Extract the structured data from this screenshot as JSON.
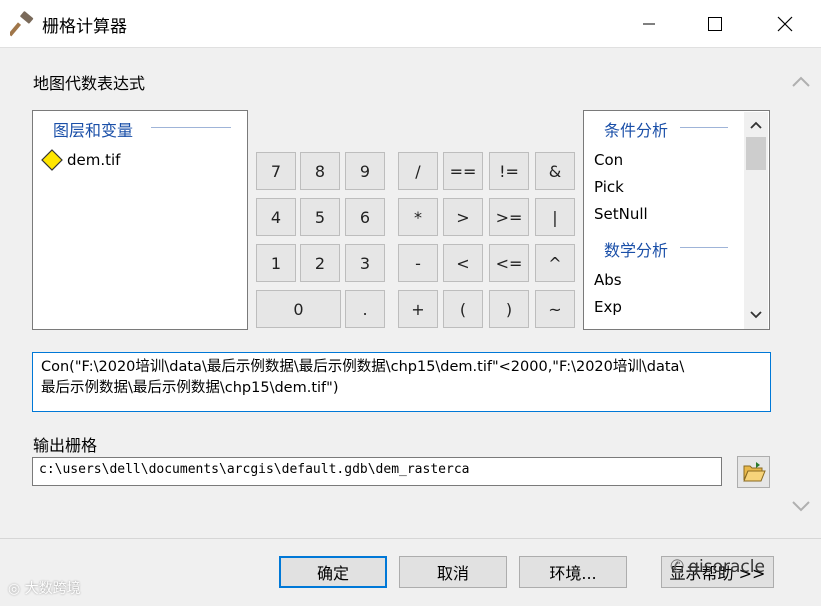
{
  "window": {
    "title": "栅格计算器"
  },
  "sections": {
    "expression_label": "地图代数表达式",
    "output_label": "输出栅格"
  },
  "layers": {
    "header": "图层和变量",
    "items": [
      "dem.tif"
    ]
  },
  "functions": {
    "group1": "条件分析",
    "group1_items": [
      "Con",
      "Pick",
      "SetNull"
    ],
    "group2": "数学分析",
    "group2_items": [
      "Abs",
      "Exp"
    ]
  },
  "keypad": {
    "row1": [
      "7",
      "8",
      "9",
      "/",
      "==",
      "!=",
      "&"
    ],
    "row2": [
      "4",
      "5",
      "6",
      "*",
      ">",
      ">=",
      "|"
    ],
    "row3": [
      "1",
      "2",
      "3",
      "-",
      "<",
      "<=",
      "^"
    ],
    "row4": [
      "0",
      ".",
      "+",
      "(",
      ")",
      "~"
    ]
  },
  "expression": {
    "line1": "Con(\"F:\\2020培训\\data\\最后示例数据\\最后示例数据\\chp15\\dem.tif\"<2000,\"F:\\2020培训\\data\\",
    "line2": "最后示例数据\\最后示例数据\\chp15\\dem.tif\")"
  },
  "output": {
    "value": "c:\\users\\dell\\documents\\arcgis\\default.gdb\\dem_rasterca"
  },
  "buttons": {
    "ok": "确定",
    "cancel": "取消",
    "env": "环境...",
    "help": "显示帮助 >>"
  },
  "watermarks": {
    "left": "大数跨境",
    "right": "gisoracle"
  },
  "colors": {
    "accent": "#0078d7",
    "group_header": "#1a4fa8",
    "diamond": "#ffe600"
  }
}
